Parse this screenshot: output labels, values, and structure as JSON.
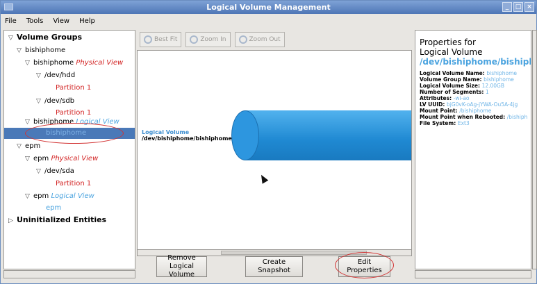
{
  "window": {
    "title": "Logical Volume Management"
  },
  "menu": {
    "file": "File",
    "tools": "Tools",
    "view": "View",
    "help": "Help"
  },
  "tree": {
    "volume_groups": "Volume Groups",
    "bishiphome": "bishiphome",
    "bishiphome_pv_name": "bishiphome",
    "physical_view": "Physical View",
    "dev_hdd": "/dev/hdd",
    "partition1_hdd": "Partition 1",
    "dev_sdb": "/dev/sdb",
    "partition1_sdb": "Partition 1",
    "bishiphome_lv_name": "bishiphome",
    "logical_view": "Logical View",
    "selected_lv": "bishiphome",
    "epm": "epm",
    "epm_pv_name": "epm",
    "epm_physical_view": "Physical View",
    "dev_sda": "/dev/sda",
    "partition1_sda": "Partition 1",
    "epm_lv_name": "epm",
    "epm_logical_view": "Logical View",
    "epm_lv": "epm",
    "uninitialized": "Uninitialized Entities"
  },
  "toolbar": {
    "best_fit": "Best Fit",
    "zoom_in": "Zoom In",
    "zoom_out": "Zoom Out"
  },
  "canvas": {
    "lv_label_title": "Logical Volume",
    "lv_label_path": "/dev/bishiphome/bishiphome"
  },
  "actions": {
    "remove": "Remove Logical Volume",
    "snapshot": "Create Snapshot",
    "edit": "Edit Properties"
  },
  "props": {
    "heading1": "Properties for",
    "heading2": "Logical Volume",
    "path": "/dev/bishiphome/bishiph",
    "rows": [
      {
        "k": "Logical Volume Name:",
        "v": "bishiphome"
      },
      {
        "k": "Volume Group Name:",
        "v": "bishiphome"
      },
      {
        "k": "Logical Volume Size:",
        "v": "12.00GB"
      },
      {
        "k": "Number of Segments:",
        "v": "1"
      },
      {
        "k": "Attributes:",
        "v": "-wi-ao"
      },
      {
        "k": "LV UUID:",
        "v": "bjG0vK-oAg-jYWA-Ou5A-4jg"
      },
      {
        "k": "Mount Point:",
        "v": "/bishiphome"
      },
      {
        "k": "Mount Point when Rebooted:",
        "v": "/bishiph"
      },
      {
        "k": "File System:",
        "v": "Ext3"
      }
    ]
  },
  "colors": {
    "accent": "#4aa3df",
    "red_label": "#d22222",
    "cylinder": "#2d96df",
    "selection": "#4a79b8",
    "annotation": "#d23333"
  }
}
